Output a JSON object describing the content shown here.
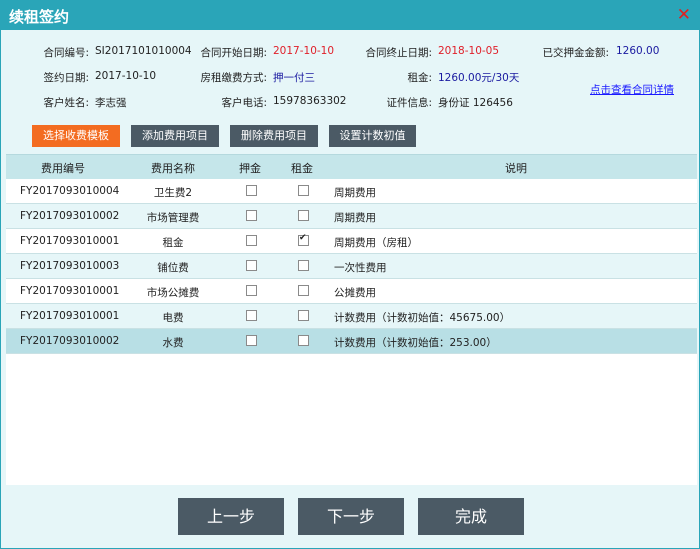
{
  "window": {
    "title": "续租签约",
    "close_glyph": "✕"
  },
  "info": {
    "contract_no_label": "合同编号:",
    "contract_no": "SI2017101010004",
    "start_label": "合同开始日期:",
    "start_date": "2017-10-10",
    "end_label": "合同终止日期:",
    "end_date": "2018-10-05",
    "deposit_label": "已交押金金额:",
    "deposit": "1260.00",
    "sign_label": "签约日期:",
    "sign_date": "2017-10-10",
    "pay_label": "房租缴费方式:",
    "pay_method": "押一付三",
    "rent_label": "租金:",
    "rent": "1260.00元/30天",
    "customer_label": "客户姓名:",
    "customer": "李志强",
    "phone_label": "客户电话:",
    "phone": "15978363302",
    "id_label": "证件信息:",
    "id_info": "身份证 126456",
    "detail_link": "点击查看合同详情"
  },
  "toolbar": {
    "template": "选择收费模板",
    "add": "添加费用项目",
    "delete": "删除费用项目",
    "set_initial": "设置计数初值"
  },
  "grid": {
    "columns": [
      "费用编号",
      "费用名称",
      "押金",
      "租金",
      "说明"
    ],
    "rows": [
      {
        "code": "FY2017093010004",
        "name": "卫生费2",
        "deposit": false,
        "rent": false,
        "desc": "周期费用"
      },
      {
        "code": "FY2017093010002",
        "name": "市场管理费",
        "deposit": false,
        "rent": false,
        "desc": "周期费用"
      },
      {
        "code": "FY2017093010001",
        "name": "租金",
        "deposit": false,
        "rent": true,
        "desc": "周期费用（房租）"
      },
      {
        "code": "FY2017093010003",
        "name": "铺位费",
        "deposit": false,
        "rent": false,
        "desc": "一次性费用"
      },
      {
        "code": "FY2017093010001",
        "name": "市场公摊费",
        "deposit": false,
        "rent": false,
        "desc": "公摊费用"
      },
      {
        "code": "FY2017093010001",
        "name": "电费",
        "deposit": false,
        "rent": false,
        "desc": "计数费用（计数初始值：45675.00）"
      },
      {
        "code": "FY2017093010002",
        "name": "水费",
        "deposit": false,
        "rent": false,
        "desc": "计数费用（计数初始值：253.00）"
      }
    ]
  },
  "footer": {
    "prev": "上一步",
    "next": "下一步",
    "finish": "完成"
  },
  "colors": {
    "titlebar": "#2aa5b8",
    "accent_orange": "#f36c21",
    "button_gray": "#4b5a65",
    "panel_bg": "#e6f6f8"
  }
}
